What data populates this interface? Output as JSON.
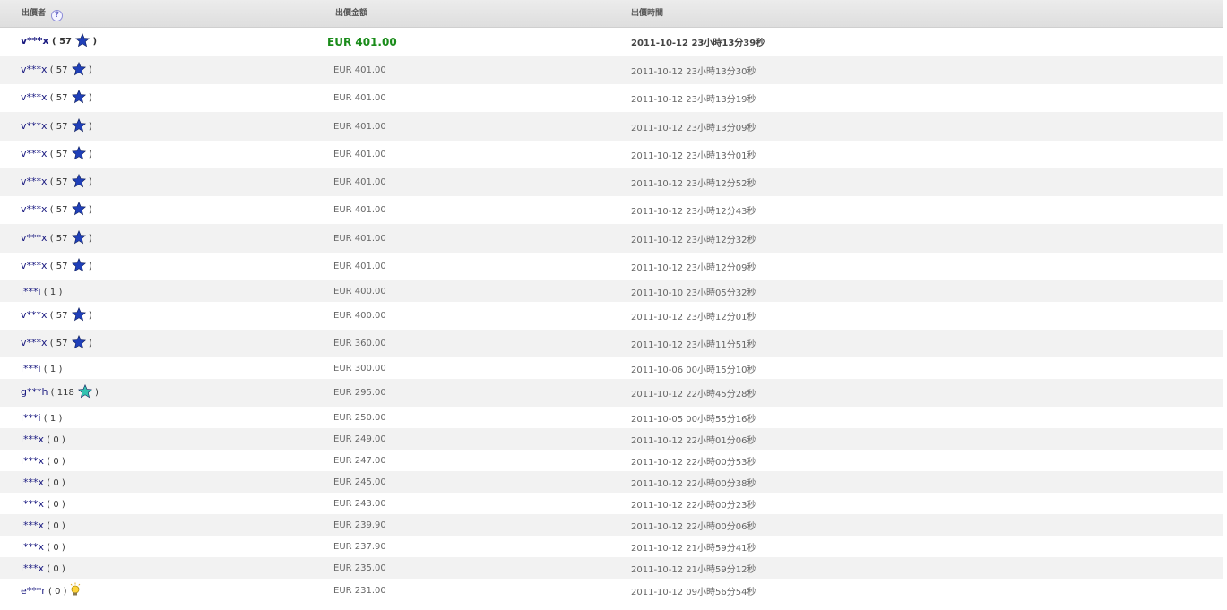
{
  "headers": {
    "bidder": "出價者",
    "amount": "出價金額",
    "time": "出價時間",
    "help_glyph": "?"
  },
  "colors": {
    "star_blue": "#1f3fb8",
    "star_teal": "#33c2b0",
    "top_amount": "#1a8c1a"
  },
  "rows": [
    {
      "name": "v***x",
      "score": "57",
      "badge": "star-blue",
      "amount": "EUR 401.00",
      "time": "2011-10-12 23小時13分39秒",
      "h": 33
    },
    {
      "name": "v***x",
      "score": "57",
      "badge": "star-blue",
      "amount": "EUR 401.00",
      "time": "2011-10-12 23小時13分30秒",
      "h": 31
    },
    {
      "name": "v***x",
      "score": "57",
      "badge": "star-blue",
      "amount": "EUR 401.00",
      "time": "2011-10-12 23小時13分19秒",
      "h": 31
    },
    {
      "name": "v***x",
      "score": "57",
      "badge": "star-blue",
      "amount": "EUR 401.00",
      "time": "2011-10-12 23小時13分09秒",
      "h": 32
    },
    {
      "name": "v***x",
      "score": "57",
      "badge": "star-blue",
      "amount": "EUR 401.00",
      "time": "2011-10-12 23小時13分01秒",
      "h": 31
    },
    {
      "name": "v***x",
      "score": "57",
      "badge": "star-blue",
      "amount": "EUR 401.00",
      "time": "2011-10-12 23小時12分52秒",
      "h": 31
    },
    {
      "name": "v***x",
      "score": "57",
      "badge": "star-blue",
      "amount": "EUR 401.00",
      "time": "2011-10-12 23小時12分43秒",
      "h": 31
    },
    {
      "name": "v***x",
      "score": "57",
      "badge": "star-blue",
      "amount": "EUR 401.00",
      "time": "2011-10-12 23小時12分32秒",
      "h": 32
    },
    {
      "name": "v***x",
      "score": "57",
      "badge": "star-blue",
      "amount": "EUR 401.00",
      "time": "2011-10-12 23小時12分09秒",
      "h": 31
    },
    {
      "name": "l***i",
      "score": "1",
      "badge": "",
      "amount": "EUR 400.00",
      "time": "2011-10-10 23小時05分32秒",
      "h": 24
    },
    {
      "name": "v***x",
      "score": "57",
      "badge": "star-blue",
      "amount": "EUR 400.00",
      "time": "2011-10-12 23小時12分01秒",
      "h": 31
    },
    {
      "name": "v***x",
      "score": "57",
      "badge": "star-blue",
      "amount": "EUR 360.00",
      "time": "2011-10-12 23小時11分51秒",
      "h": 31
    },
    {
      "name": "l***i",
      "score": "1",
      "badge": "",
      "amount": "EUR 300.00",
      "time": "2011-10-06 00小時15分10秒",
      "h": 24
    },
    {
      "name": "g***h",
      "score": "118",
      "badge": "star-teal",
      "amount": "EUR 295.00",
      "time": "2011-10-12 22小時45分28秒",
      "h": 31
    },
    {
      "name": "l***i",
      "score": "1",
      "badge": "",
      "amount": "EUR 250.00",
      "time": "2011-10-05 00小時55分16秒",
      "h": 24
    },
    {
      "name": "i***x",
      "score": "0",
      "badge": "",
      "amount": "EUR 249.00",
      "time": "2011-10-12 22小時01分06秒",
      "h": 24
    },
    {
      "name": "i***x",
      "score": "0",
      "badge": "",
      "amount": "EUR 247.00",
      "time": "2011-10-12 22小時00分53秒",
      "h": 24
    },
    {
      "name": "i***x",
      "score": "0",
      "badge": "",
      "amount": "EUR 245.00",
      "time": "2011-10-12 22小時00分38秒",
      "h": 24
    },
    {
      "name": "i***x",
      "score": "0",
      "badge": "",
      "amount": "EUR 243.00",
      "time": "2011-10-12 22小時00分23秒",
      "h": 24
    },
    {
      "name": "i***x",
      "score": "0",
      "badge": "",
      "amount": "EUR 239.90",
      "time": "2011-10-12 22小時00分06秒",
      "h": 24
    },
    {
      "name": "i***x",
      "score": "0",
      "badge": "",
      "amount": "EUR 237.90",
      "time": "2011-10-12 21小時59分41秒",
      "h": 24
    },
    {
      "name": "i***x",
      "score": "0",
      "badge": "",
      "amount": "EUR 235.00",
      "time": "2011-10-12 21小時59分12秒",
      "h": 24
    },
    {
      "name": "e***r",
      "score": "0",
      "badge": "bulb",
      "amount": "EUR 231.00",
      "time": "2011-10-12 09小時56分54秒",
      "h": 27
    }
  ]
}
